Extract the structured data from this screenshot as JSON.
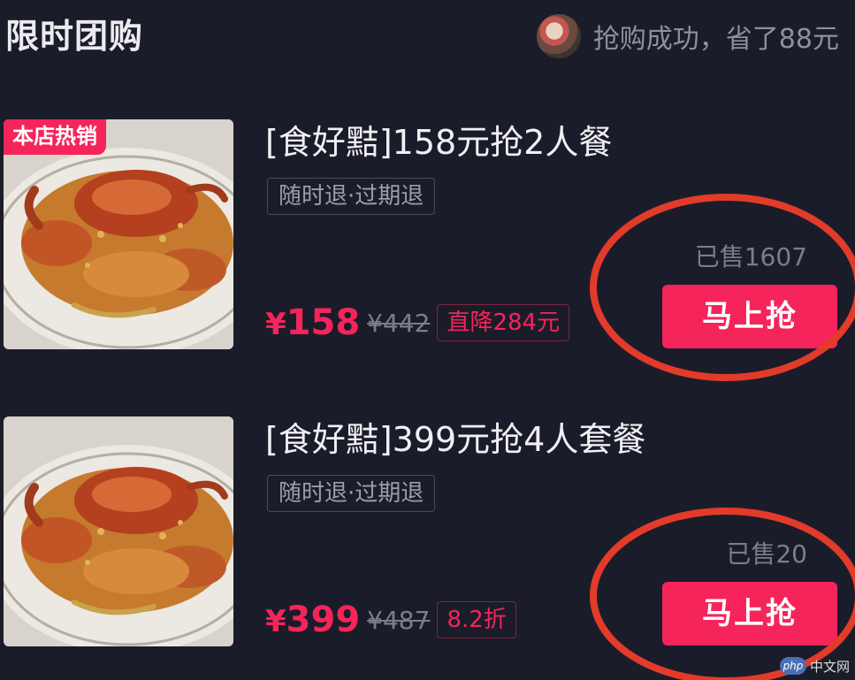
{
  "header": {
    "title": "限时团购",
    "success_text": "抢购成功，省了88元"
  },
  "products": [
    {
      "badge": "本店热销",
      "title": "[食好黠]158元抢2人餐",
      "refund_tag": "随时退·过期退",
      "currency": "¥",
      "price": "158",
      "old_price": "¥442",
      "discount": "直降284元",
      "sold": "已售1607",
      "button": "马上抢"
    },
    {
      "title": "[食好黠]399元抢4人套餐",
      "refund_tag": "随时退·过期退",
      "currency": "¥",
      "price": "399",
      "old_price": "¥487",
      "discount": "8.2折",
      "sold": "已售20",
      "button": "马上抢"
    }
  ],
  "watermark": {
    "logo": "php",
    "text": "中文网"
  },
  "colors": {
    "background": "#1b1c29",
    "accent": "#f5245a",
    "annotation": "#e23b2a"
  }
}
